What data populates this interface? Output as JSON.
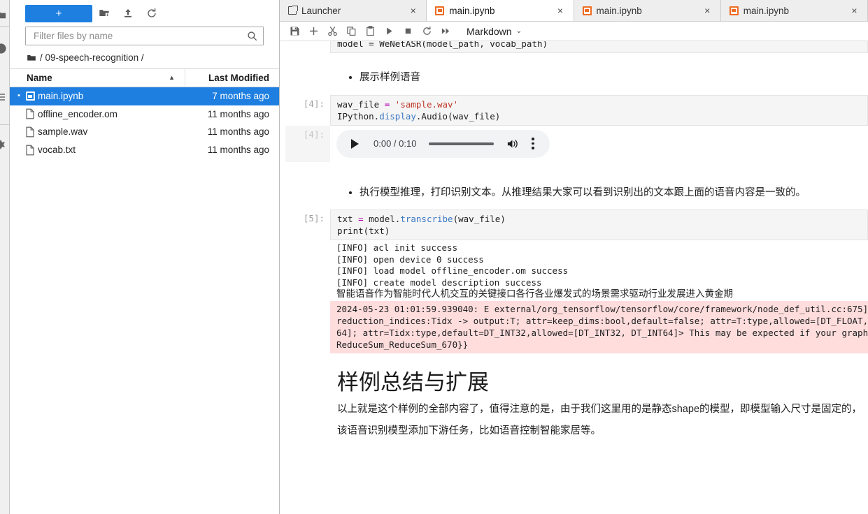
{
  "activity_bar": {
    "icons": [
      "folder-icon",
      "terminal-icon",
      "list-icon",
      "puzzle-icon"
    ]
  },
  "file_browser": {
    "new_launcher_label": "+",
    "toolbar_icons": [
      "new-folder-icon",
      "upload-icon",
      "refresh-icon"
    ],
    "filter": {
      "placeholder": "Filter files by name",
      "value": "",
      "icon": "search-icon"
    },
    "breadcrumb": {
      "root_icon": "folder-icon",
      "path": "/ 09-speech-recognition /"
    },
    "columns": {
      "name": "Name",
      "last_modified": "Last Modified",
      "sort_caret": "▲"
    },
    "rows": [
      {
        "name": "main.ipynb",
        "modified": "7 months ago",
        "icon": "notebook-icon",
        "selected": true,
        "dot": "•"
      },
      {
        "name": "offline_encoder.om",
        "modified": "11 months ago",
        "icon": "file-icon",
        "selected": false,
        "dot": "•"
      },
      {
        "name": "sample.wav",
        "modified": "11 months ago",
        "icon": "file-icon",
        "selected": false,
        "dot": "•"
      },
      {
        "name": "vocab.txt",
        "modified": "11 months ago",
        "icon": "file-icon",
        "selected": false,
        "dot": "•"
      }
    ]
  },
  "tabs": [
    {
      "label": "Launcher",
      "icon": "launcher-icon",
      "close": "×",
      "active": false
    },
    {
      "label": "main.ipynb",
      "icon": "notebook-icon",
      "close": "×",
      "active": true
    },
    {
      "label": "main.ipynb",
      "icon": "notebook-icon",
      "close": "×",
      "active": false
    },
    {
      "label": "main.ipynb",
      "icon": "notebook-icon",
      "close": "×",
      "active": false
    }
  ],
  "notebook_toolbar": {
    "buttons": [
      "save-icon",
      "add-cell-icon",
      "cut-icon",
      "copy-icon",
      "paste-icon",
      "run-icon",
      "stop-icon",
      "restart-icon",
      "restart-run-all-icon"
    ],
    "cell_type": "Markdown",
    "cell_type_caret": "⌄"
  },
  "notebook": {
    "cell_partial_top": {
      "prompt": "",
      "code": "model = WeNetASR(model_path, vocab_path)"
    },
    "markdown_1": {
      "bullet": "展示样例语音"
    },
    "cell_4": {
      "prompt": "[4]:",
      "line1_a": "wav_file ",
      "line1_op": "=",
      "line1_b": " 'sample.wav'",
      "line2": "IPython.display.Audio(wav_file)"
    },
    "output_4": {
      "prompt": "[4]:",
      "audio": {
        "play_icon": "play-icon",
        "time": "0:00 / 0:10",
        "volume_icon": "volume-icon",
        "menu_icon": "more-vertical-icon"
      }
    },
    "markdown_2": {
      "bullet": "执行模型推理，打印识别文本。从推理结果大家可以看到识别出的文本跟上面的语音内容是一致的。"
    },
    "cell_5": {
      "prompt": "[5]:",
      "line1": "txt = model.transcribe(wav_file)",
      "line2": "print(txt)"
    },
    "output_5": {
      "stream_lines": [
        "[INFO] acl init success",
        "[INFO] open device 0 success",
        "[INFO] load model offline_encoder.om success",
        "[INFO] create model description success"
      ],
      "transcription": "智能语音作为智能时代人机交互的关键接口各行各业爆发式的场景需求驱动行业发展进入黄金期",
      "error_lines": [
        "2024-05-23 01:01:59.939040: E external/org_tensorflow/tensorflow/core/framework/node_def_util.cc:675]",
        "reduction_indices:Tidx -> output:T; attr=keep_dims:bool,default=false; attr=T:type,allowed=[DT_FLOAT,",
        "64]; attr=Tidx:type,default=DT_INT32,allowed=[DT_INT32, DT_INT64]> This may be expected if your graph",
        "ReduceSum_ReduceSum_670}}"
      ]
    },
    "markdown_3": {
      "heading": "样例总结与扩展",
      "paragraph_line1": "以上就是这个样例的全部内容了，值得注意的是，由于我们这里用的是静态shape的模型，即模型输入尺寸是固定的，",
      "paragraph_line2": "该语音识别模型添加下游任务，比如语音控制智能家居等。"
    }
  },
  "colors": {
    "accent_blue": "#1e7fe0",
    "notebook_orange": "#ee6c21",
    "error_bg": "#fdd",
    "code_bg": "#f5f5f5"
  }
}
